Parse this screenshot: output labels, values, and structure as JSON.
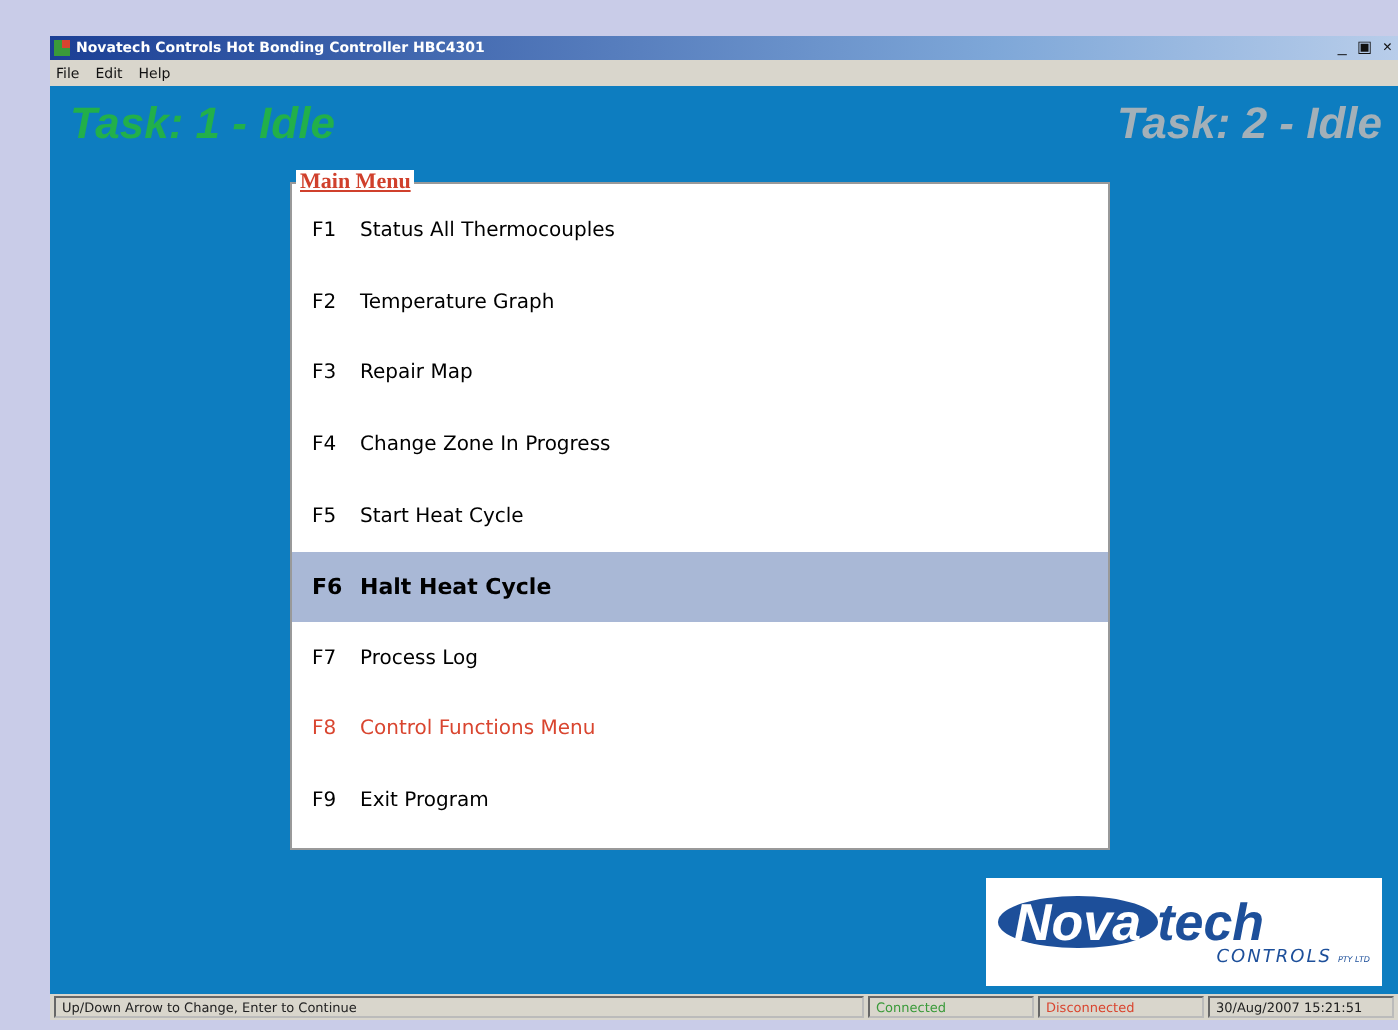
{
  "window": {
    "title": "Novatech Controls Hot Bonding Controller HBC4301",
    "controls": [
      "_",
      "▣",
      "×"
    ]
  },
  "menu_bar": [
    "File",
    "Edit",
    "Help"
  ],
  "tasks": [
    {
      "label": "Task: 1 - Idle",
      "color": "#22b04a"
    },
    {
      "label": "Task: 2 - Idle",
      "color": "#a3b0b8"
    }
  ],
  "main_menu": {
    "title": "Main Menu",
    "items": [
      {
        "key": "F1",
        "label": "Status All Thermocouples",
        "selected": false,
        "color": "#000000"
      },
      {
        "key": "F2",
        "label": "Temperature Graph",
        "selected": false,
        "color": "#000000"
      },
      {
        "key": "F3",
        "label": "Repair Map",
        "selected": false,
        "color": "#000000"
      },
      {
        "key": "F4",
        "label": "Change Zone In Progress",
        "selected": false,
        "color": "#000000"
      },
      {
        "key": "F5",
        "label": "Start Heat Cycle",
        "selected": false,
        "color": "#000000"
      },
      {
        "key": "F6",
        "label": "Halt Heat Cycle",
        "selected": true,
        "color": "#000000"
      },
      {
        "key": "F7",
        "label": "Process Log",
        "selected": false,
        "color": "#000000"
      },
      {
        "key": "F8",
        "label": "Control Functions Menu",
        "selected": false,
        "color": "#d9452f"
      },
      {
        "key": "F9",
        "label": "Exit Program",
        "selected": false,
        "color": "#000000"
      }
    ]
  },
  "logo": {
    "name_oval": "Nova",
    "name_rest": "tech",
    "subtitle": "CONTROLS",
    "suffix": "PTY LTD"
  },
  "status_bar": [
    {
      "text": "Up/Down Arrow to Change,  Enter to Continue",
      "color": "#222222"
    },
    {
      "text": "Connected",
      "color": "#3a9a3a"
    },
    {
      "text": "Disconnected",
      "color": "#d9452f"
    },
    {
      "text": "30/Aug/2007  15:21:51",
      "color": "#222222"
    }
  ]
}
